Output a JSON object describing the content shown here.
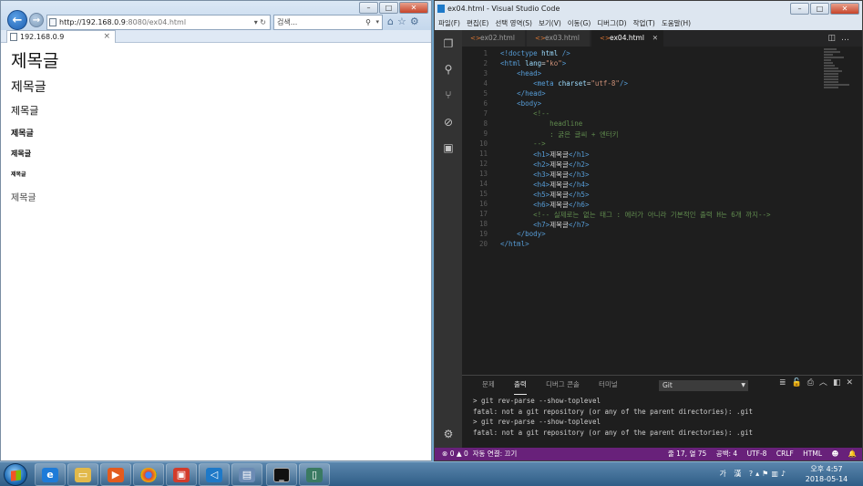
{
  "ie": {
    "address_host": "http://192.168.0.9",
    "address_path": ":8080/ex04.html",
    "search_placeholder": "검색...",
    "tab_title": "192.168.0.9",
    "tab_close": "×",
    "headings": {
      "h1": "제목글",
      "h2": "제목글",
      "h3": "제목글",
      "h4": "제목글",
      "h5": "제목글",
      "h6": "제목글",
      "h7": "제목글"
    }
  },
  "vscode": {
    "window_title": "ex04.html - Visual Studio Code",
    "menu": [
      "파일(F)",
      "편집(E)",
      "선택 영역(S)",
      "보기(V)",
      "이동(G)",
      "디버그(D)",
      "작업(T)",
      "도움말(H)"
    ],
    "tabs": [
      {
        "label": "ex02.html",
        "active": false
      },
      {
        "label": "ex03.html",
        "active": false
      },
      {
        "label": "ex04.html",
        "active": true
      }
    ],
    "panel": {
      "tabs": [
        "문제",
        "출력",
        "디버그 콘솔",
        "터미널"
      ],
      "active_tab": "출력",
      "channel": "Git",
      "output_lines": [
        "> git rev-parse --show-toplevel",
        "fatal: not a git repository (or any of the parent directories): .git",
        "> git rev-parse --show-toplevel",
        "fatal: not a git repository (or any of the parent directories): .git"
      ]
    },
    "status": {
      "errors": "0",
      "warnings": "0",
      "auto_attach": "자동 연결: 끄기",
      "position": "줄 17, 열 75",
      "spaces": "공백: 4",
      "encoding": "UTF-8",
      "eol": "CRLF",
      "language": "HTML"
    }
  },
  "taskbar": {
    "ime": "가 漢",
    "time": "오후 4:57",
    "date": "2018-05-14"
  },
  "colors": {
    "vscode_status": "#68217a",
    "vscode_bg": "#1e1e1e"
  }
}
